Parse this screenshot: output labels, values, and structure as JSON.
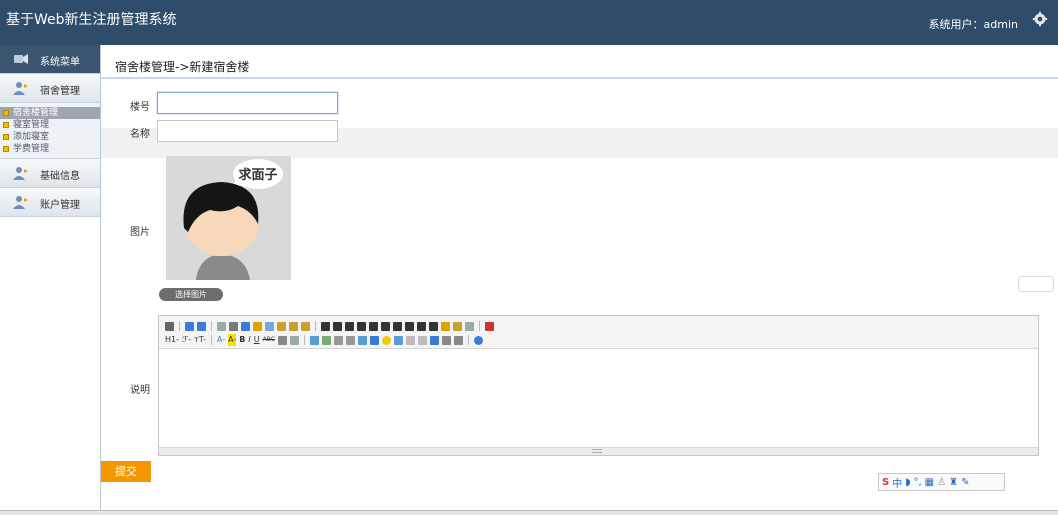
{
  "header": {
    "title": "基于Web新生注册管理系统",
    "user_label": "系统用户：admin"
  },
  "sidebar": {
    "menu_title": "系统菜单",
    "groups": [
      {
        "label": "宿舍管理"
      },
      {
        "label": "基础信息"
      },
      {
        "label": "账户管理"
      }
    ],
    "subitems": [
      {
        "label": "宿舍楼管理",
        "active": true
      },
      {
        "label": "寝室管理",
        "active": false
      },
      {
        "label": "添加寝室",
        "active": false
      },
      {
        "label": "学费管理",
        "active": false
      }
    ]
  },
  "main": {
    "breadcrumb": "宿舍楼管理->新建宿舍楼",
    "form": {
      "building_no_label": "楼号",
      "building_no_value": "",
      "name_label": "名称",
      "name_value": "",
      "image_label": "图片",
      "avatar_caption": "求面子",
      "pick_image_button": "选择图片",
      "desc_label": "说明",
      "submit_button": "提交"
    },
    "editor_toolbar": {
      "row2_text": [
        "H1-",
        "ℱ-",
        "тT-",
        "A-",
        "A-",
        "B",
        "I",
        "U",
        "ABC"
      ]
    }
  },
  "ime": {
    "text": "中"
  },
  "colors": {
    "topbar": "#2f4d6a",
    "submit": "#f39800",
    "accent": "#9cc0e8"
  }
}
